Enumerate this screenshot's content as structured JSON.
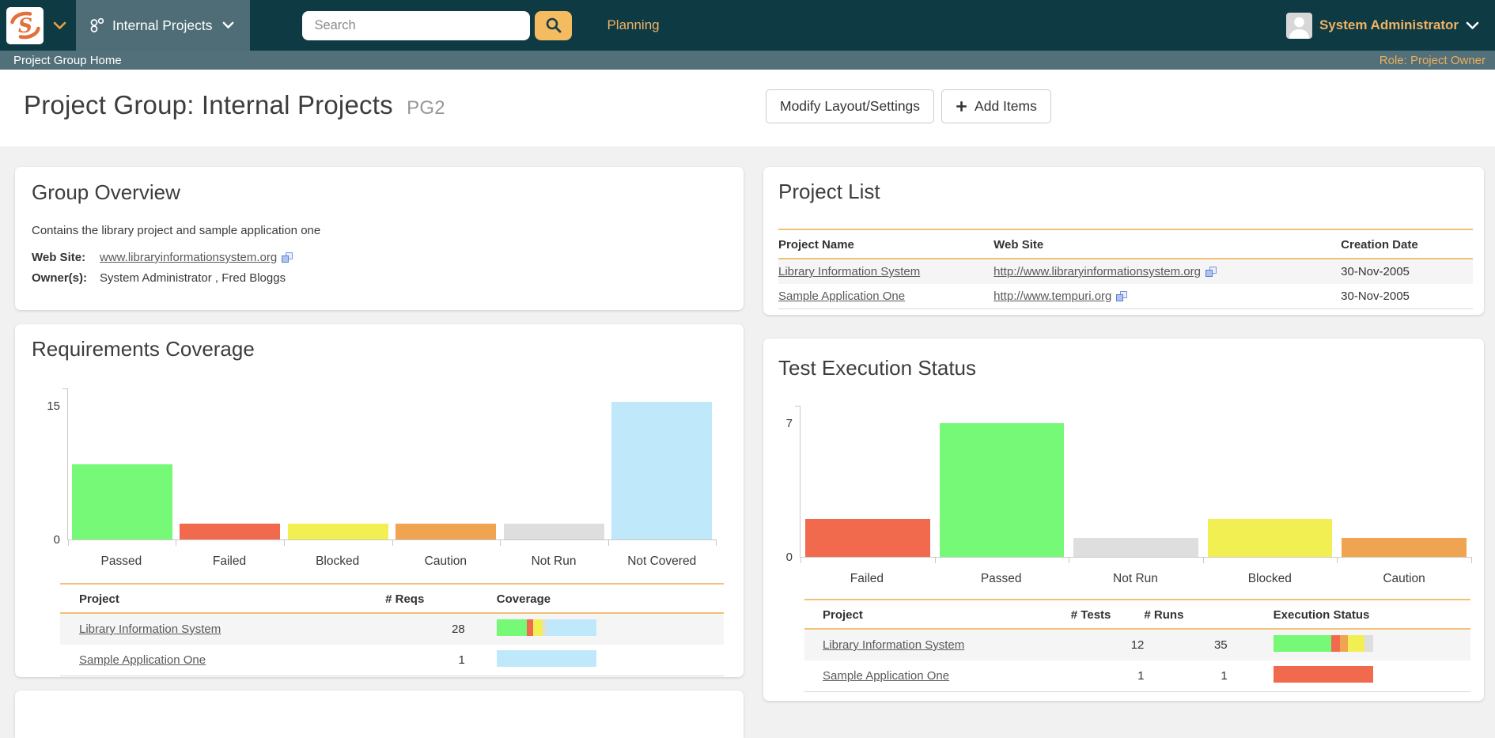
{
  "topbar": {
    "workspace_label": "Internal Projects",
    "search_placeholder": "Search",
    "planning_label": "Planning",
    "user_name": "System Administrator"
  },
  "statusbar": {
    "breadcrumb": "Project Group Home",
    "role": "Role: Project Owner"
  },
  "header": {
    "title": "Project Group: Internal Projects",
    "tag": "PG2",
    "modify_button": "Modify Layout/Settings",
    "add_button": "Add Items"
  },
  "group_overview": {
    "title": "Group Overview",
    "description": "Contains the library project and sample application one",
    "website_label": "Web Site:",
    "website_url": "www.libraryinformationsystem.org",
    "owners_label": "Owner(s):",
    "owners_value": "System Administrator , Fred Bloggs"
  },
  "project_list": {
    "title": "Project List",
    "columns": [
      "Project Name",
      "Web Site",
      "Creation Date"
    ],
    "rows": [
      {
        "name": "Library Information System",
        "url": "http://www.libraryinformationsystem.org",
        "date": "30-Nov-2005"
      },
      {
        "name": "Sample Application One",
        "url": "http://www.tempuri.org",
        "date": "30-Nov-2005"
      }
    ]
  },
  "requirements_coverage": {
    "title": "Requirements Coverage",
    "columns": [
      "Project",
      "# Reqs",
      "Coverage"
    ],
    "rows": [
      {
        "name": "Library Information System",
        "reqs": "28",
        "bar": [
          [
            "#76f976",
            30.5
          ],
          [
            "#f26a4e",
            6
          ],
          [
            "#f2ef53",
            9.5
          ],
          [
            "#dedede",
            4.5
          ],
          [
            "#bfe9fb",
            49.5
          ]
        ]
      },
      {
        "name": "Sample Application One",
        "reqs": "1",
        "bar": [
          [
            "#bfe9fb",
            100
          ]
        ]
      }
    ]
  },
  "test_execution": {
    "title": "Test Execution Status",
    "columns": [
      "Project",
      "# Tests",
      "# Runs",
      "Execution Status"
    ],
    "rows": [
      {
        "name": "Library Information System",
        "tests": "12",
        "runs": "35",
        "bar": [
          [
            "#76f976",
            58.3
          ],
          [
            "#f26a4e",
            8.3
          ],
          [
            "#f0a351",
            8.3
          ],
          [
            "#f2ef53",
            16.8
          ],
          [
            "#dedede",
            8.3
          ]
        ]
      },
      {
        "name": "Sample Application One",
        "tests": "1",
        "runs": "1",
        "bar": [
          [
            "#f26a4e",
            100
          ]
        ]
      }
    ]
  },
  "chart_data": [
    {
      "type": "bar",
      "title": "Requirements Coverage",
      "categories": [
        "Passed",
        "Failed",
        "Blocked",
        "Caution",
        "Not Run",
        "Not Covered"
      ],
      "values": [
        8.5,
        1.8,
        1.8,
        1.8,
        1.8,
        15.5
      ],
      "colors": [
        "#76f976",
        "#f26a4e",
        "#f2ef53",
        "#f0a351",
        "#dedede",
        "#bfe9fb"
      ],
      "xlabel": "",
      "ylabel": "",
      "ylim": [
        0,
        17
      ],
      "yticks": [
        {
          "value": 0,
          "label": "0"
        },
        {
          "value": 15,
          "label": "15"
        }
      ],
      "grid": false,
      "legend": "none"
    },
    {
      "type": "bar",
      "title": "Test Execution Status",
      "categories": [
        "Failed",
        "Passed",
        "Not Run",
        "Blocked",
        "Caution"
      ],
      "values": [
        2,
        7,
        1,
        2,
        1
      ],
      "colors": [
        "#f26a4e",
        "#76f976",
        "#dedede",
        "#f2ef53",
        "#f0a351"
      ],
      "xlabel": "",
      "ylabel": "",
      "ylim": [
        0,
        7.9
      ],
      "yticks": [
        {
          "value": 0,
          "label": "0"
        },
        {
          "value": 7,
          "label": "7"
        }
      ],
      "grid": false,
      "legend": "none"
    }
  ],
  "colors": {
    "topbar_bg": "#0e3a44",
    "workspace_bg": "#4e6d76",
    "statusbar_bg": "#52707a",
    "accent_orange_text": "#f1b264",
    "search_button": "#f4bb60",
    "table_border_orange": "#f3c077",
    "link_gray": "#595959",
    "row_alt_bg": "#f5f5f5"
  }
}
